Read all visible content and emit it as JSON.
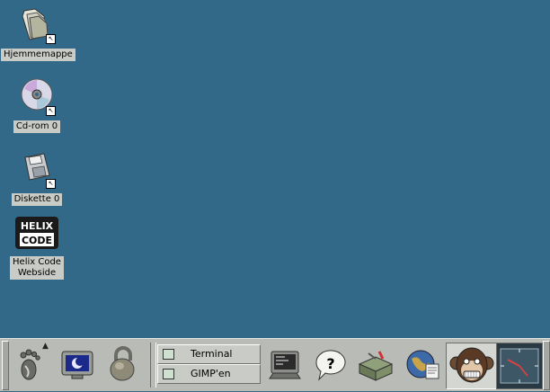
{
  "desktop": {
    "icons": [
      {
        "id": "home",
        "label": "Hjemmemappe",
        "icon": "folder-icon"
      },
      {
        "id": "cdrom",
        "label": "Cd-rom 0",
        "icon": "cdrom-icon"
      },
      {
        "id": "floppy",
        "label": "Diskette 0",
        "icon": "floppy-icon"
      },
      {
        "id": "helix",
        "label": "Helix Code\nWebside",
        "icon": "helix-code-logo"
      }
    ],
    "helix_logo": {
      "line1": "HELIX",
      "line2": "CODE"
    },
    "shortcut_arrow": "↖"
  },
  "panel": {
    "menu_arrow": "▲",
    "launchers": [
      {
        "id": "gnome-foot",
        "icon": "gnome-foot-icon"
      },
      {
        "id": "screensaver",
        "icon": "monitor-moon-icon"
      },
      {
        "id": "lock",
        "icon": "padlock-icon"
      },
      {
        "id": "terminal",
        "icon": "terminal-icon"
      },
      {
        "id": "help",
        "icon": "help-icon",
        "glyph": "?"
      },
      {
        "id": "control-center",
        "icon": "toolbox-icon"
      },
      {
        "id": "browser",
        "icon": "globe-icon"
      }
    ],
    "tasks": [
      {
        "label": "Terminal"
      },
      {
        "label": "GIMP'en"
      }
    ],
    "applet": {
      "icon": "monkey-face-icon"
    },
    "clock": {
      "icon": "analog-clock-icon"
    }
  },
  "colors": {
    "desktop": "#336988",
    "panel": "#b9bbb6"
  }
}
